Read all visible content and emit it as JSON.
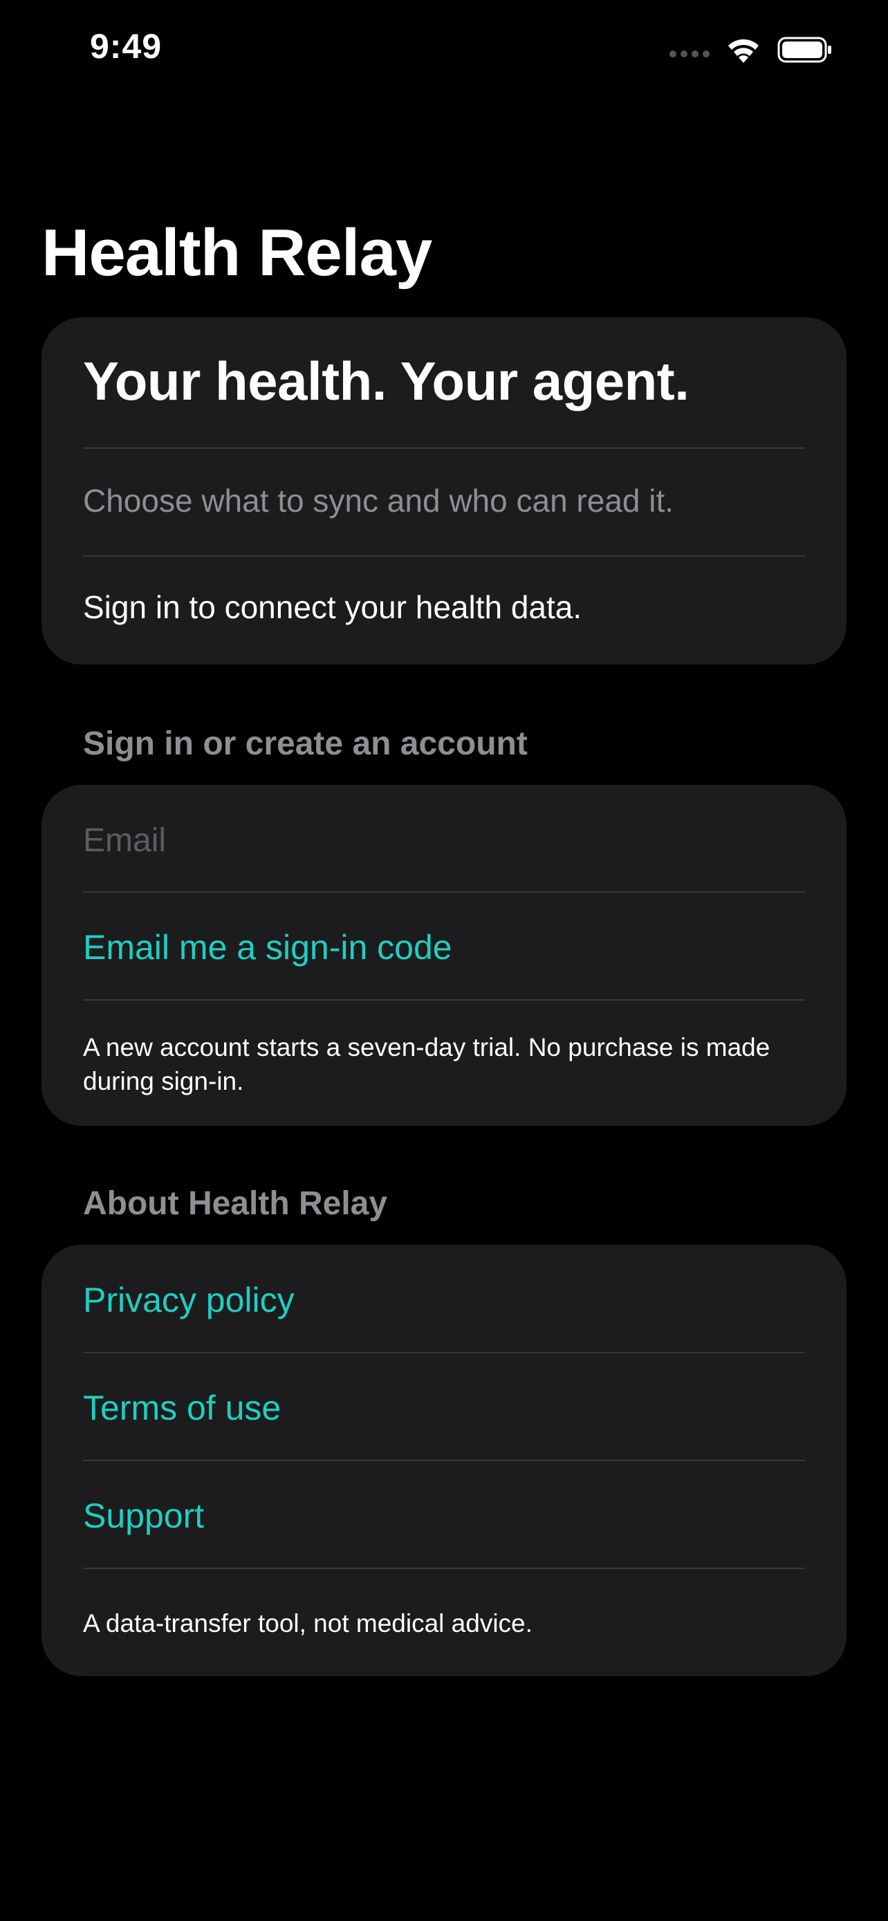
{
  "status_bar": {
    "time": "9:49",
    "signal_icon": "cellular-signal-icon",
    "wifi_icon": "wifi-icon",
    "battery_icon": "battery-icon"
  },
  "page": {
    "title": "Health Relay"
  },
  "hero": {
    "heading": "Your health. Your agent.",
    "subtitle": "Choose what to sync and who can read it.",
    "note": "Sign in to connect your health data."
  },
  "signin": {
    "header": "Sign in or create an account",
    "email_placeholder": "Email",
    "email_value": "",
    "send_code_label": "Email me a sign-in code",
    "footnote": "A new account starts a seven-day trial. No purchase is made during sign-in."
  },
  "about": {
    "header": "About Health Relay",
    "links": [
      {
        "label": "Privacy policy"
      },
      {
        "label": "Terms of use"
      },
      {
        "label": "Support"
      }
    ],
    "footnote": "A data-transfer tool, not medical advice."
  },
  "colors": {
    "background": "#000000",
    "card": "#1c1c1e",
    "accent": "#1fcfc1",
    "secondary_text": "#8e8e93",
    "divider": "#38383a"
  }
}
